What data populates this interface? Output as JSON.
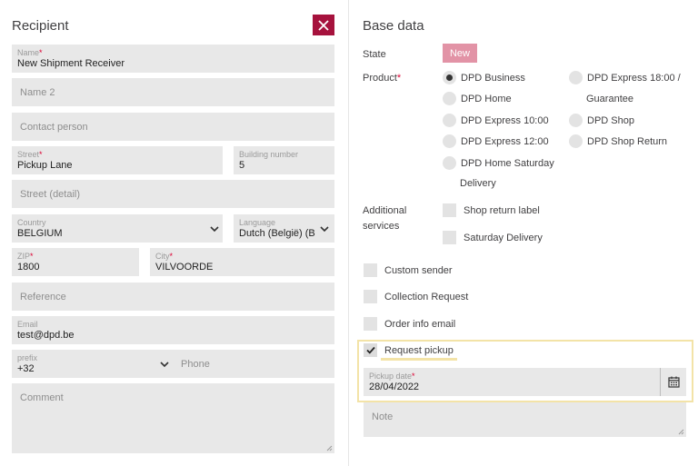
{
  "recipient": {
    "title": "Recipient",
    "name": {
      "label": "Name",
      "required_mark": "*",
      "value": "New Shipment Receiver"
    },
    "name2": {
      "placeholder": "Name 2"
    },
    "contact_person": {
      "placeholder": "Contact person"
    },
    "street": {
      "label": "Street",
      "required_mark": "*",
      "value": "Pickup Lane"
    },
    "building_number": {
      "label": "Building number",
      "value": "5"
    },
    "street_detail": {
      "placeholder": "Street (detail)"
    },
    "country": {
      "label": "Country",
      "value": "BELGIUM"
    },
    "language": {
      "label": "Language",
      "value": "Dutch (België) (B"
    },
    "zip": {
      "label": "ZIP",
      "required_mark": "*",
      "value": "1800"
    },
    "city": {
      "label": "City",
      "required_mark": "*",
      "value": "VILVOORDE"
    },
    "reference": {
      "placeholder": "Reference"
    },
    "email": {
      "label": "Email",
      "value": "test@dpd.be"
    },
    "prefix": {
      "label": "prefix",
      "value": "+32"
    },
    "phone": {
      "placeholder": "Phone"
    },
    "comment": {
      "placeholder": "Comment"
    }
  },
  "base_data": {
    "title": "Base data",
    "state_label": "State",
    "state_value": "New",
    "product_label": "Product",
    "product_required_mark": "*",
    "products_col1": [
      {
        "label": "DPD Business",
        "selected": true
      },
      {
        "label": "DPD Home",
        "selected": false
      },
      {
        "label": "DPD Express 10:00",
        "selected": false
      },
      {
        "label": "DPD Express 12:00",
        "selected": false
      },
      {
        "label": "DPD Home Saturday",
        "label_line2": "Delivery",
        "selected": false
      }
    ],
    "products_col2": [
      {
        "label": "DPD Express 18:00 /",
        "label_line2": "Guarantee",
        "selected": false
      },
      {
        "label": "DPD Shop",
        "selected": false
      },
      {
        "label": "DPD Shop Return",
        "selected": false
      }
    ],
    "additional_services_label_line1": "Additional",
    "additional_services_label_line2": "services",
    "additional_services": [
      {
        "label": "Shop return label",
        "checked": false
      },
      {
        "label": "Saturday Delivery",
        "checked": false
      }
    ],
    "options": [
      {
        "label": "Custom sender",
        "checked": false
      },
      {
        "label": "Collection Request",
        "checked": false
      },
      {
        "label": "Order info email",
        "checked": false
      },
      {
        "label": "Request pickup",
        "checked": true
      }
    ],
    "pickup_date": {
      "label": "Pickup date",
      "required_mark": "*",
      "value": "28/04/2022"
    },
    "note": {
      "placeholder": "Note"
    }
  },
  "icons": {
    "close": "close-icon",
    "chevron": "chevron-down-icon",
    "calendar": "calendar-icon",
    "check": "check-icon"
  },
  "colors": {
    "accent": "#a6123d",
    "state_badge": "#e293a6",
    "highlight": "#f3e3a7",
    "field_bg": "#e8e8e8",
    "required": "#dc0032"
  }
}
